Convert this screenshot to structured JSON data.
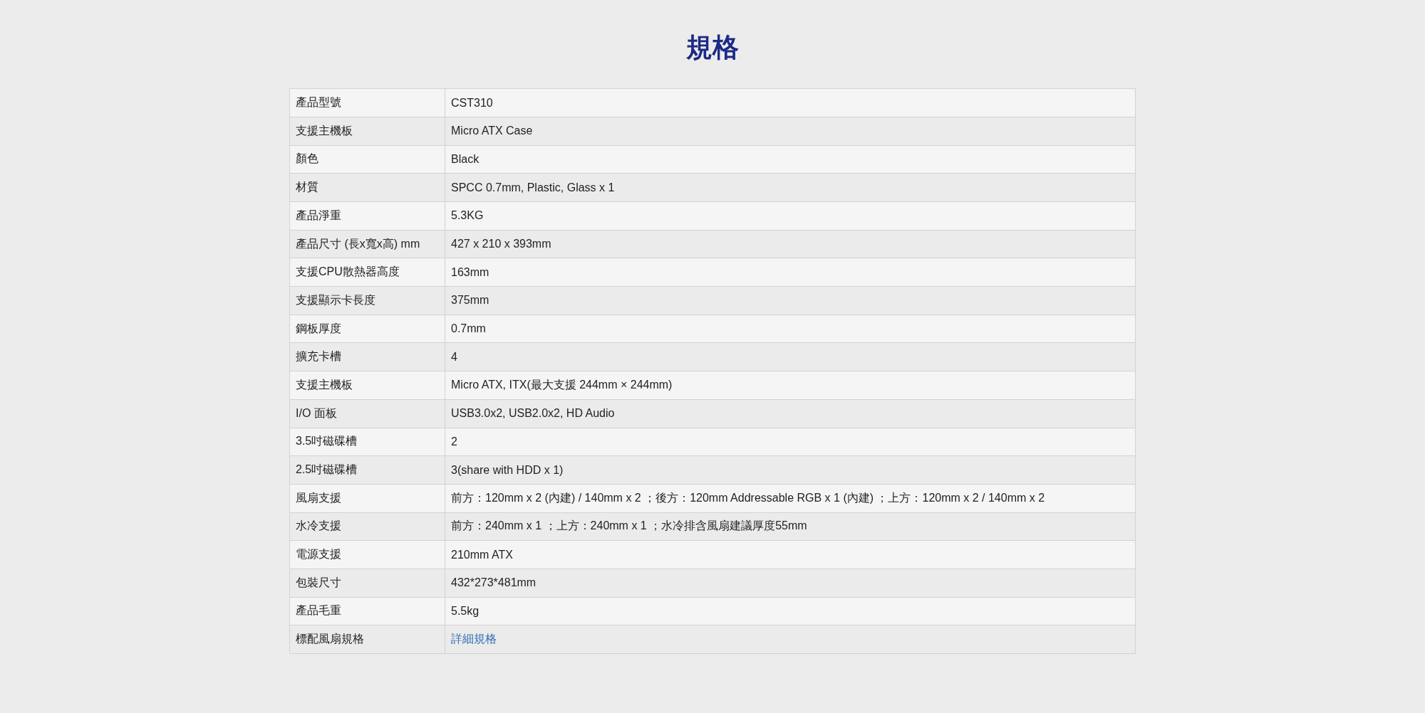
{
  "title": "規格",
  "spec_table": {
    "rows": [
      {
        "label": "產品型號",
        "value": "CST310",
        "kind": "text"
      },
      {
        "label": "支援主機板",
        "value": "Micro ATX Case",
        "kind": "text"
      },
      {
        "label": "顏色",
        "value": "Black",
        "kind": "text"
      },
      {
        "label": "材質",
        "value": "SPCC 0.7mm, Plastic, Glass x 1",
        "kind": "text"
      },
      {
        "label": "產品淨重",
        "value": "5.3KG",
        "kind": "text"
      },
      {
        "label": "產品尺寸 (長x寬x高) mm",
        "value": "427 x 210 x 393mm",
        "kind": "text"
      },
      {
        "label": "支援CPU散熱器高度",
        "value": "163mm",
        "kind": "text"
      },
      {
        "label": "支援顯示卡長度",
        "value": "375mm",
        "kind": "text"
      },
      {
        "label": "鋼板厚度",
        "value": "0.7mm",
        "kind": "text"
      },
      {
        "label": "擴充卡槽",
        "value": "4",
        "kind": "text"
      },
      {
        "label": "支援主機板",
        "value": "Micro ATX, ITX(最大支援 244mm × 244mm)",
        "kind": "text"
      },
      {
        "label": "I/O 面板",
        "value": "USB3.0x2, USB2.0x2, HD Audio",
        "kind": "text"
      },
      {
        "label": "3.5吋磁碟槽",
        "value": "2",
        "kind": "text"
      },
      {
        "label": "2.5吋磁碟槽",
        "value": "3(share with HDD x 1)",
        "kind": "text"
      },
      {
        "label": "風扇支援",
        "value": "前方：120mm x 2 (內建) / 140mm x 2 ；後方：120mm Addressable RGB x 1 (內建) ；上方：120mm x 2 / 140mm x 2",
        "kind": "text"
      },
      {
        "label": "水冷支援",
        "value": "前方：240mm x 1 ；上方：240mm x 1 ；水冷排含風扇建議厚度55mm",
        "kind": "text"
      },
      {
        "label": "電源支援",
        "value": "210mm ATX",
        "kind": "text"
      },
      {
        "label": "包裝尺寸",
        "value": "432*273*481mm",
        "kind": "text"
      },
      {
        "label": "產品毛重",
        "value": "5.5kg",
        "kind": "text"
      },
      {
        "label": "標配風扇規格",
        "value": "詳細規格",
        "kind": "link"
      }
    ]
  }
}
